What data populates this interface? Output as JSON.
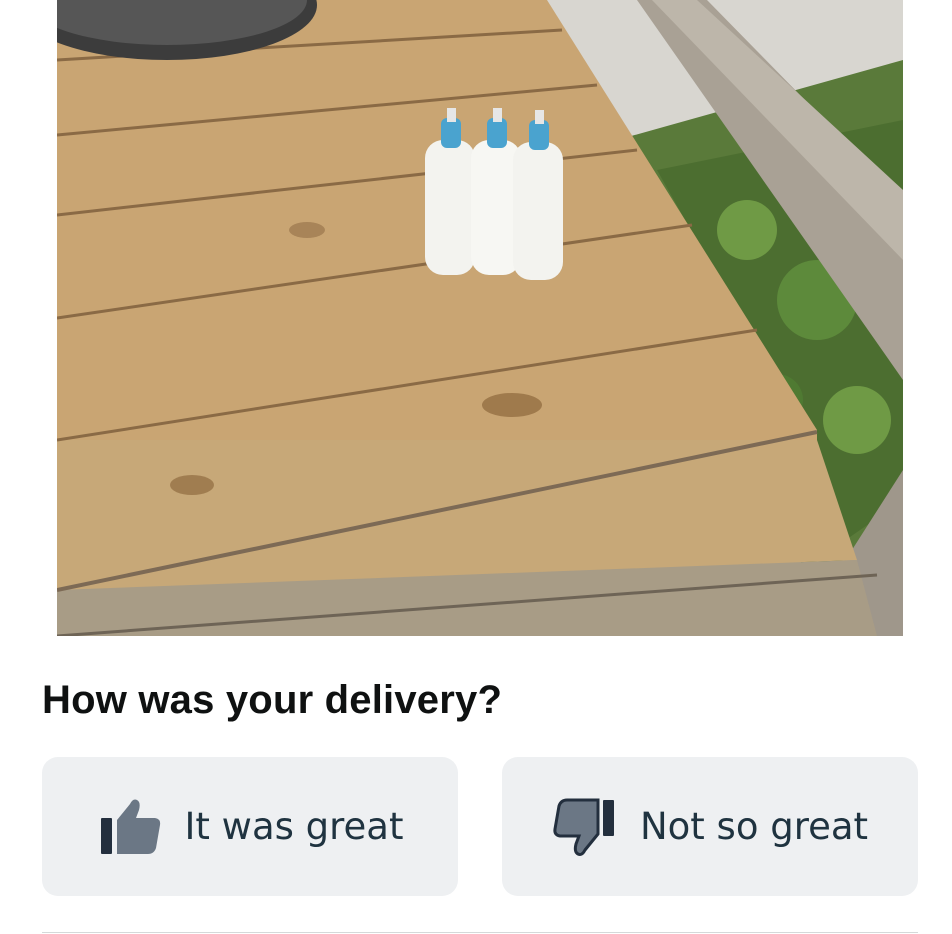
{
  "photo": {
    "icon": "delivery-photo"
  },
  "feedback": {
    "question": "How was your delivery?",
    "positive_label": "It was great",
    "positive_icon": "thumbs-up-icon",
    "negative_label": "Not so great",
    "negative_icon": "thumbs-down-icon"
  },
  "colors": {
    "button_bg": "#eef0f2",
    "icon_dark": "#232f3e",
    "icon_light": "#6b7785",
    "text": "#0f1111"
  }
}
